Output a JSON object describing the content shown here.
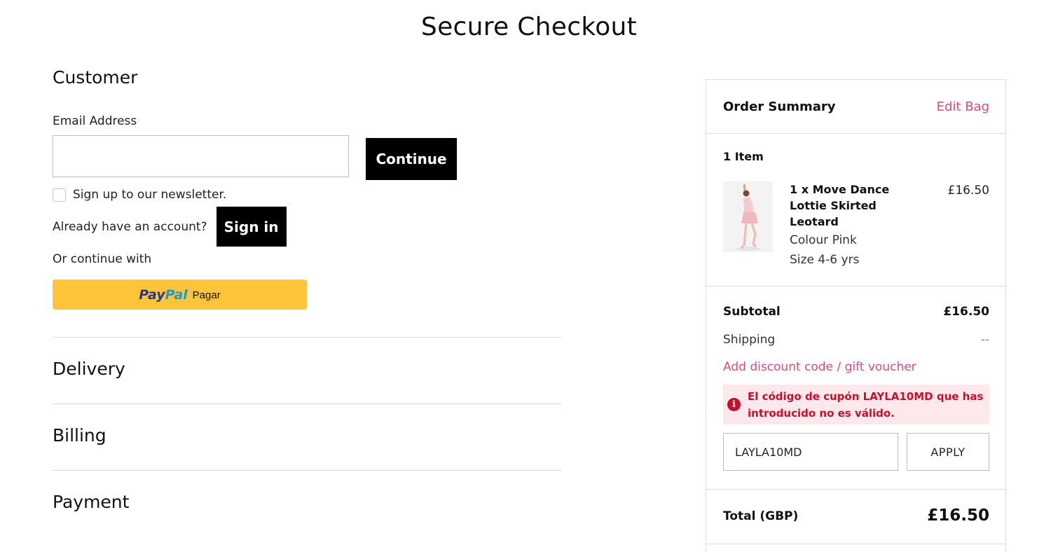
{
  "page": {
    "title": "Secure Checkout"
  },
  "customer": {
    "heading": "Customer",
    "email_label": "Email Address",
    "email_value": "",
    "continue_label": "Continue",
    "newsletter_label": "Sign up to our newsletter.",
    "newsletter_checked": false,
    "account_prompt": "Already have an account?",
    "sign_in_label": "Sign in",
    "or_continue": "Or continue with",
    "paypal": {
      "logo_pay": "Pay",
      "logo_pal": "Pal",
      "label": "Pagar",
      "color": "#ffc439"
    }
  },
  "sections": {
    "delivery": "Delivery",
    "billing": "Billing",
    "payment": "Payment"
  },
  "summary": {
    "title": "Order Summary",
    "edit_bag": "Edit Bag",
    "item_count": "1 Item",
    "item": {
      "name": "1 x Move Dance Lottie Skirted Leotard",
      "price": "£16.50",
      "colour": "Colour Pink",
      "size": "Size 4-6 yrs"
    },
    "subtotal_label": "Subtotal",
    "subtotal_value": "£16.50",
    "shipping_label": "Shipping",
    "shipping_value": "--",
    "discount_link": "Add discount code / gift voucher",
    "error_icon": "info-icon",
    "error_message": "El código de cupón LAYLA10MD que has introducido no es válido.",
    "code_value": "LAYLA10MD",
    "apply_label": "APPLY",
    "total_label": "Total (GBP)",
    "total_value": "£16.50"
  },
  "colors": {
    "accent": "#d94b7b",
    "error": "#c8102e",
    "error_bg": "#fde8ec",
    "button": "#000000"
  }
}
